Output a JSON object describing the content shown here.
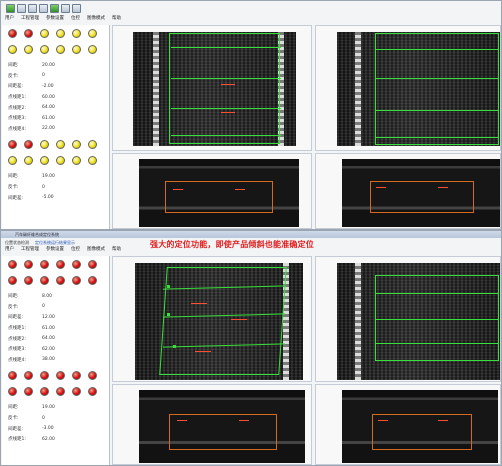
{
  "top_window": {
    "menu": [
      "用户",
      "工程管理",
      "参数设置",
      "位控",
      "图像模式",
      "帮助"
    ],
    "group1_params": [
      {
        "label": "间距:",
        "value": "20.00"
      },
      {
        "label": "反卡:",
        "value": "0"
      },
      {
        "label": "间距差:",
        "value": "-2.00"
      },
      {
        "label": "点线距1:",
        "value": "60.00"
      },
      {
        "label": "点线距2:",
        "value": "64.00"
      },
      {
        "label": "点线距3:",
        "value": "61.00"
      },
      {
        "label": "点线距4:",
        "value": "22.00"
      }
    ],
    "group2_params": [
      {
        "label": "间距:",
        "value": "19.00"
      },
      {
        "label": "反卡:",
        "value": "0"
      },
      {
        "label": "间距差:",
        "value": "-5.00"
      }
    ]
  },
  "bottom_window": {
    "title": "汽车碳纤维合成定位系统",
    "tabs": [
      "位置状态检测",
      "定位系统运行结果显示"
    ],
    "menu": [
      "用户",
      "工程管理",
      "参数设置",
      "位控",
      "图像模式",
      "帮助"
    ],
    "group1_params": [
      {
        "label": "间距:",
        "value": "8.00"
      },
      {
        "label": "反卡:",
        "value": "0"
      },
      {
        "label": "间距差:",
        "value": "12.00"
      },
      {
        "label": "点线距1:",
        "value": "61.00"
      },
      {
        "label": "点线距2:",
        "value": "64.00"
      },
      {
        "label": "点线距3:",
        "value": "62.00"
      },
      {
        "label": "点线距4:",
        "value": "38.00"
      }
    ],
    "group2_params": [
      {
        "label": "间距:",
        "value": "19.00"
      },
      {
        "label": "反卡:",
        "value": "0"
      },
      {
        "label": "间距差:",
        "value": "-3.00"
      },
      {
        "label": "点线距1:",
        "value": "62.00"
      }
    ]
  },
  "banner": "强大的定位功能，即使产品倾斜也能准确定位",
  "colors": {
    "green": "#38e03a",
    "red_led": "#d3120d",
    "yellow_led": "#f0e21c",
    "banner": "#e11d1d"
  }
}
